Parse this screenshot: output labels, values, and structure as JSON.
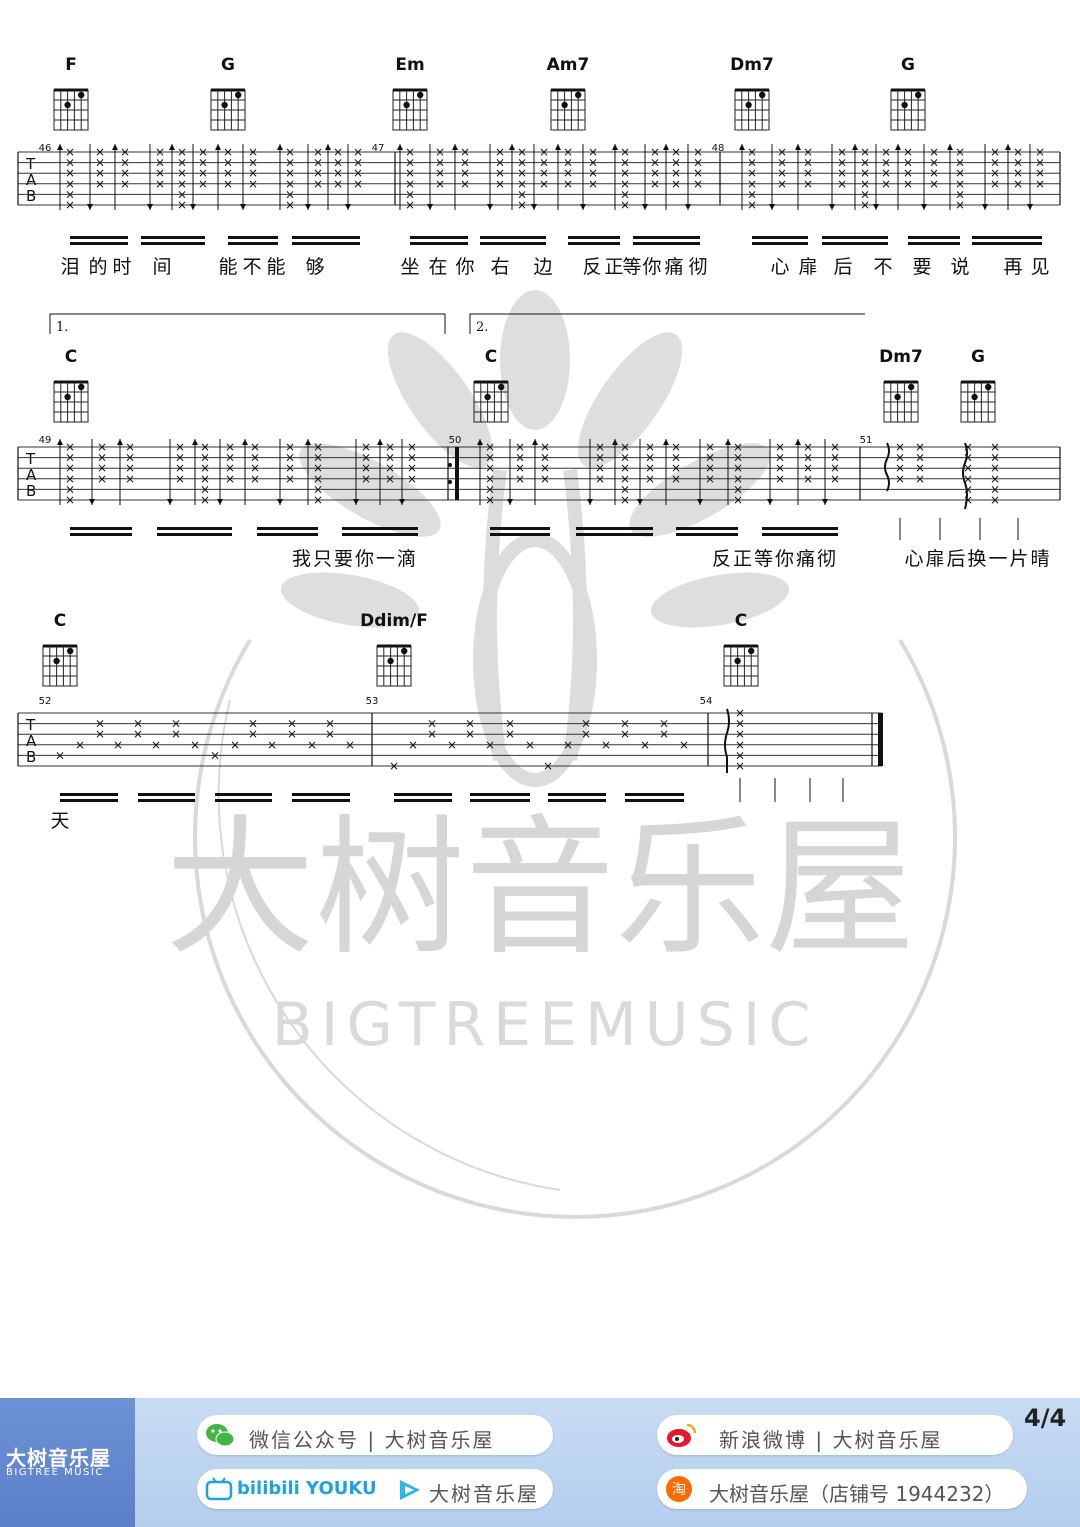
{
  "watermark": {
    "brand_cn": "大树音乐屋",
    "brand_en": "BIGTREEMUSIC"
  },
  "system1": {
    "measure_numbers": [
      "46",
      "47",
      "48"
    ],
    "chords": [
      {
        "name": "F",
        "fret_label": ""
      },
      {
        "name": "G",
        "fret_label": ""
      },
      {
        "name": "Em",
        "fret_label": ""
      },
      {
        "name": "Am7",
        "fret_label": ""
      },
      {
        "name": "Dm7",
        "fret_label": ""
      },
      {
        "name": "G",
        "fret_label": ""
      }
    ],
    "lyrics": [
      {
        "text": "泪"
      },
      {
        "text": "的"
      },
      {
        "text": "时"
      },
      {
        "text": "间"
      },
      {
        "text": "能"
      },
      {
        "text": "不"
      },
      {
        "text": "能"
      },
      {
        "text": "够"
      },
      {
        "text": "坐"
      },
      {
        "text": "在"
      },
      {
        "text": "你"
      },
      {
        "text": "右"
      },
      {
        "text": "边"
      },
      {
        "text": "反"
      },
      {
        "text": "正"
      },
      {
        "text": "等"
      },
      {
        "text": "你"
      },
      {
        "text": "痛"
      },
      {
        "text": "彻"
      },
      {
        "text": "心"
      },
      {
        "text": "扉"
      },
      {
        "text": "后"
      },
      {
        "text": "不"
      },
      {
        "text": "要"
      },
      {
        "text": "说"
      },
      {
        "text": "再"
      },
      {
        "text": "见"
      }
    ]
  },
  "system2": {
    "measure_numbers": [
      "49",
      "50",
      "51"
    ],
    "volta_labels": [
      "1.",
      "2."
    ],
    "chords": [
      {
        "name": "C"
      },
      {
        "name": "C"
      },
      {
        "name": "Dm7"
      },
      {
        "name": "G"
      }
    ],
    "lyric_groups": [
      "我只要你一滴",
      "反正等你痛彻",
      "心扉后换一片晴"
    ]
  },
  "system3": {
    "measure_numbers": [
      "52",
      "53",
      "54"
    ],
    "chords": [
      {
        "name": "C"
      },
      {
        "name": "Ddim/F"
      },
      {
        "name": "C"
      }
    ],
    "lyric_groups": [
      "天"
    ]
  },
  "tab_clef": [
    "T",
    "A",
    "B"
  ],
  "footer": {
    "logo_cn": "大树音乐屋",
    "logo_en": "BIGTREE MUSIC",
    "wechat": "微信公众号 | 大树音乐屋",
    "video_sites": "bilibili YOUKU",
    "video_account": "大树音乐屋",
    "weibo": "新浪微博 | 大树音乐屋",
    "shop": "大树音乐屋（店铺号 1944232）",
    "page_number": "4/4"
  },
  "colors": {
    "footer_bg": "#c0d6f1",
    "logo_bg": "#6688d0",
    "watermark": "#cfcfcf",
    "ink": "#111111"
  }
}
